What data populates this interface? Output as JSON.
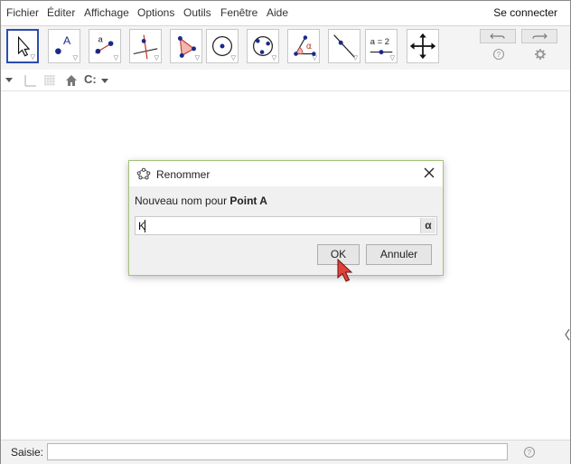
{
  "menu": {
    "items": [
      "Fichier",
      "Éditer",
      "Affichage",
      "Options",
      "Outils",
      "Fenêtre",
      "Aide"
    ],
    "signin": "Se connecter"
  },
  "toolbar": {
    "tools": [
      {
        "name": "move-tool",
        "icon": "arrow-pointer-icon"
      },
      {
        "name": "point-tool",
        "icon": "point-A-icon",
        "label": "A"
      },
      {
        "name": "line-tool",
        "icon": "line-through-two-points-icon",
        "label": "a"
      },
      {
        "name": "perpendicular-tool",
        "icon": "perpendicular-line-icon"
      },
      {
        "name": "polygon-tool",
        "icon": "polygon-icon"
      },
      {
        "name": "circle-tool",
        "icon": "circle-center-point-icon"
      },
      {
        "name": "circle-three-points-tool",
        "icon": "circle-three-points-icon"
      },
      {
        "name": "angle-tool",
        "icon": "angle-icon",
        "label": "α"
      },
      {
        "name": "reflect-tool",
        "icon": "reflect-line-icon"
      },
      {
        "name": "slider-tool",
        "icon": "slider-icon",
        "label": "a = 2"
      },
      {
        "name": "move-graphics-tool",
        "icon": "move-graphics-view-icon"
      }
    ],
    "undo_icon": "undo-icon",
    "redo_icon": "redo-icon",
    "help_icon": "help-icon",
    "settings_icon": "gear-icon"
  },
  "stylebar": {
    "graphics_style": "C:"
  },
  "dialog": {
    "title": "Renommer",
    "prompt_text": "Nouveau nom pour ",
    "prompt_object": "Point A",
    "input_value": "K",
    "alpha_symbol": "α",
    "ok_label": "OK",
    "cancel_label": "Annuler"
  },
  "inputbar": {
    "label": "Saisie:"
  },
  "colors": {
    "accent_blue": "#2b4cae",
    "dialog_border": "#a3c27a",
    "point_blue": "#1a2a8a",
    "point_red": "#c0392b"
  }
}
